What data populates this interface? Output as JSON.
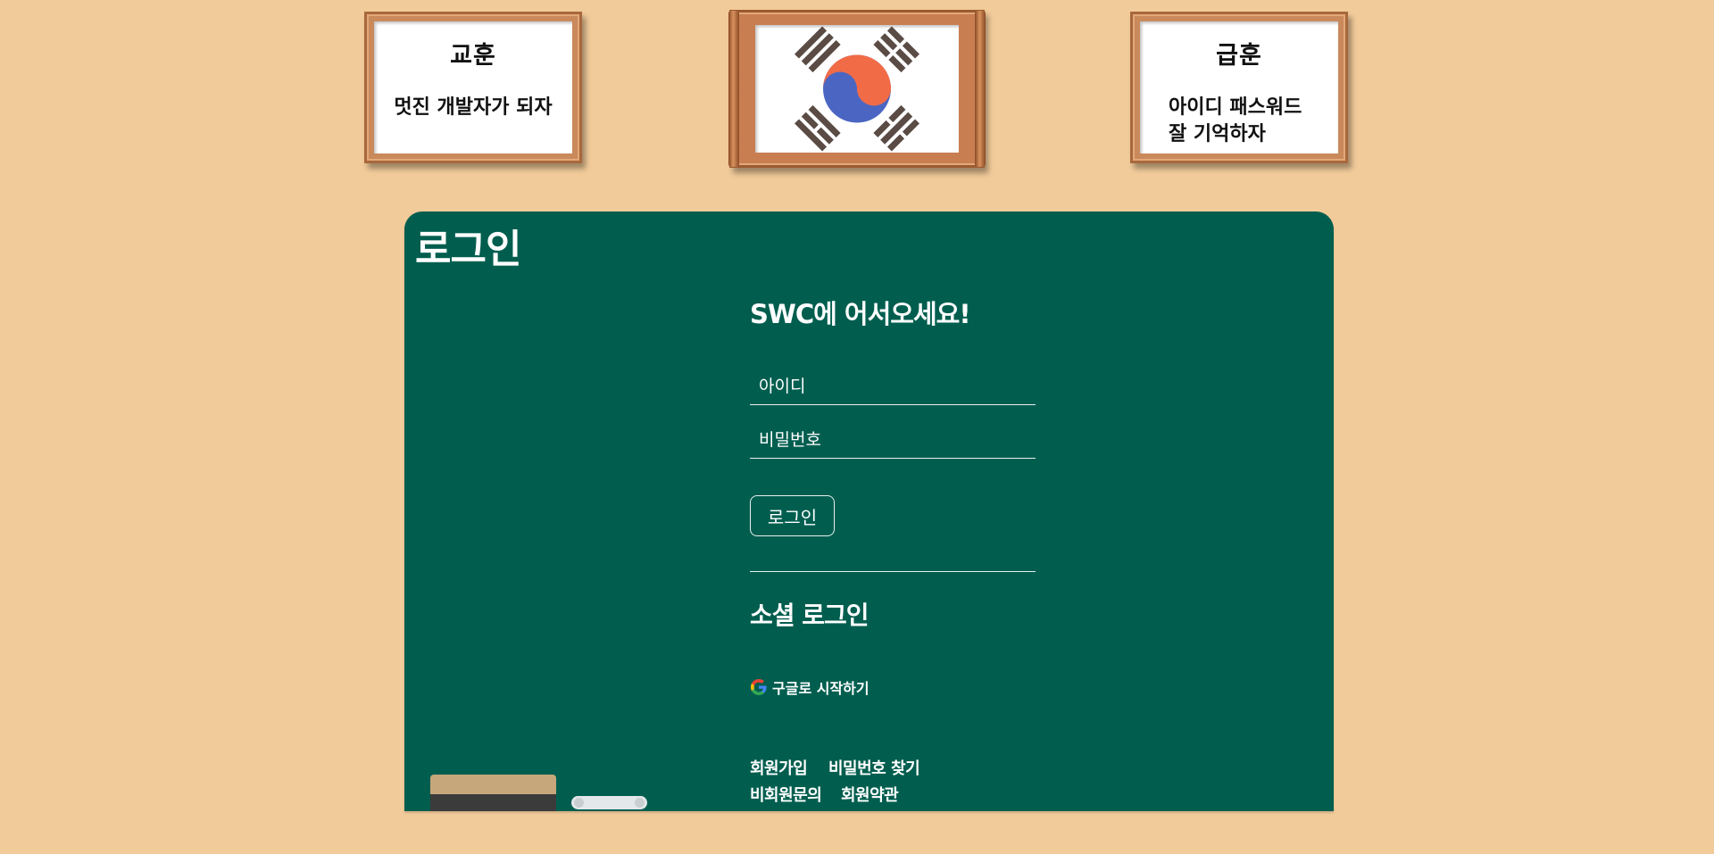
{
  "motto": {
    "title": "교훈",
    "text": "멋진 개발자가 되자"
  },
  "flag": {
    "icon": "korean-flag-icon"
  },
  "rule": {
    "title": "급훈",
    "line1": "아이디 패스워드",
    "line2": "잘 기억하자"
  },
  "board": {
    "title": "로그인",
    "welcome": "SWC에 어서오세요!",
    "id_placeholder": "아이디",
    "pw_placeholder": "비밀번호",
    "login_button": "로그인",
    "social_title": "소셜 로그인",
    "google_label": "구글로 시작하기",
    "links": {
      "signup": "회원가입",
      "find_password": "비밀번호 찾기",
      "guest_inquiry": "비회원문의",
      "terms": "회원약관"
    }
  },
  "colors": {
    "background": "#f2cb9a",
    "board": "#015e4f",
    "text_on_board": "#ffffff"
  }
}
